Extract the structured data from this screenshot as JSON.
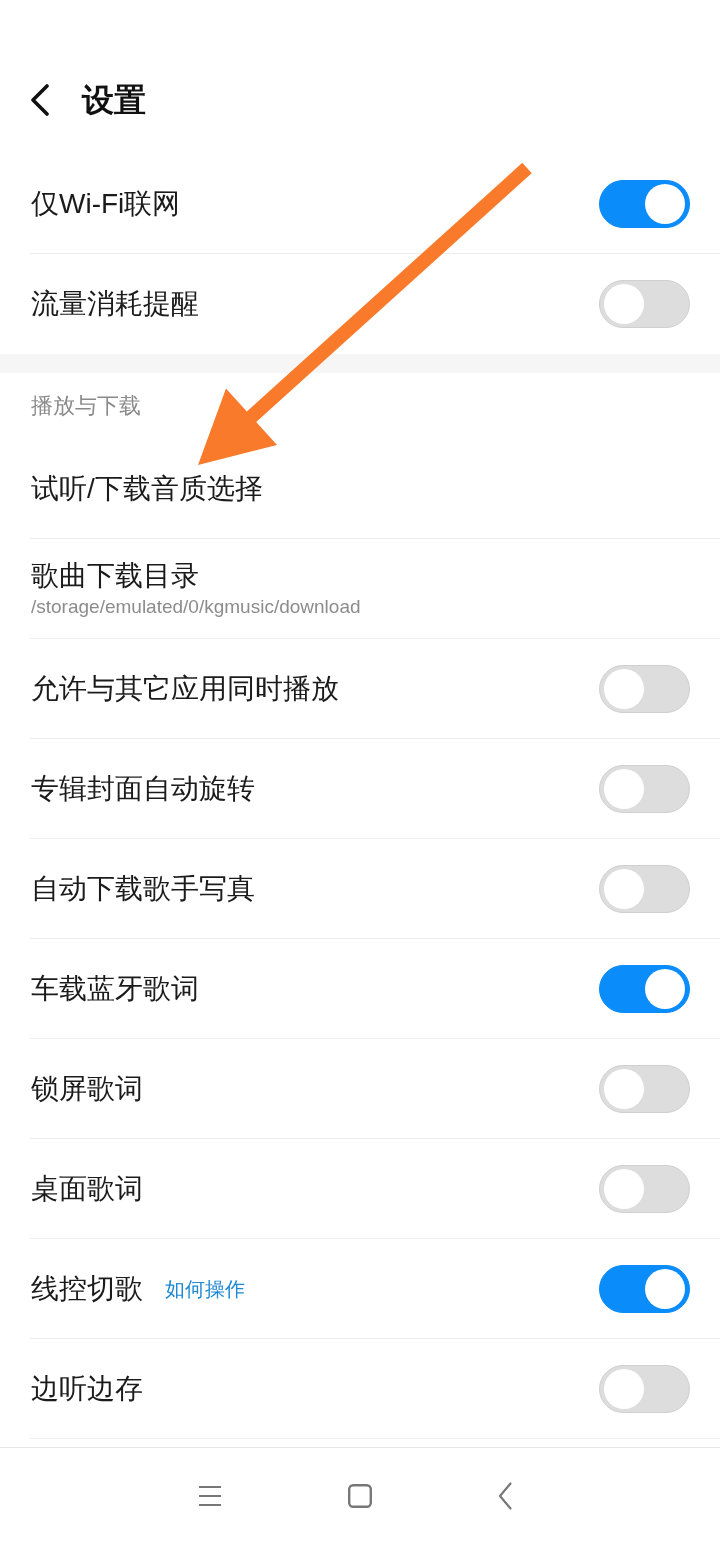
{
  "header": {
    "title": "设置"
  },
  "sections": [
    {
      "items": [
        {
          "kind": "toggle",
          "label": "仅Wi-Fi联网",
          "on": true
        },
        {
          "kind": "toggle",
          "label": "流量消耗提醒",
          "on": false
        }
      ]
    },
    {
      "title": "播放与下载",
      "items": [
        {
          "kind": "entry",
          "label": "试听/下载音质选择"
        },
        {
          "kind": "entry",
          "label": "歌曲下载目录",
          "subtitle": "/storage/emulated/0/kgmusic/download"
        },
        {
          "kind": "toggle",
          "label": "允许与其它应用同时播放",
          "on": false
        },
        {
          "kind": "toggle",
          "label": "专辑封面自动旋转",
          "on": false
        },
        {
          "kind": "toggle",
          "label": "自动下载歌手写真",
          "on": false
        },
        {
          "kind": "toggle",
          "label": "车载蓝牙歌词",
          "on": true
        },
        {
          "kind": "toggle",
          "label": "锁屏歌词",
          "on": false
        },
        {
          "kind": "toggle",
          "label": "桌面歌词",
          "on": false
        },
        {
          "kind": "toggle",
          "label": "线控切歌",
          "help_link": "如何操作",
          "on": true
        },
        {
          "kind": "toggle",
          "label": "边听边存",
          "on": false
        }
      ]
    }
  ]
}
